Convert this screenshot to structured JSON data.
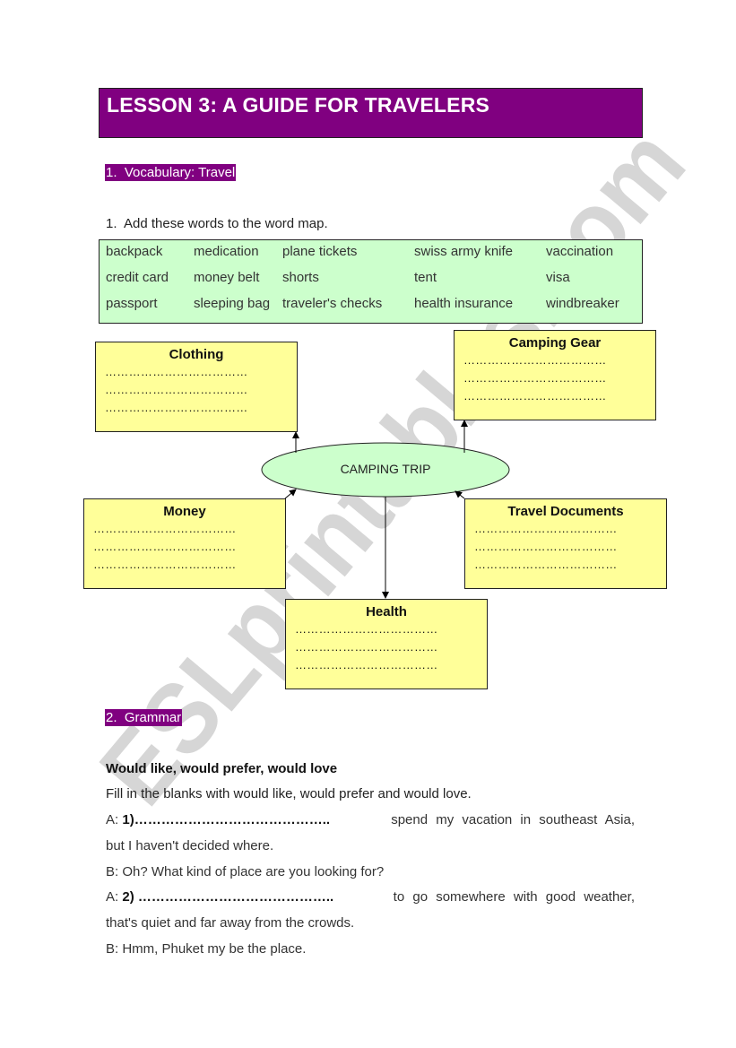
{
  "title": "LESSON 3: A GUIDE FOR TRAVELERS",
  "colors": {
    "accent_purple": "#800080",
    "word_box_green": "#ccffcc",
    "category_yellow": "#ffff99",
    "center_ellipse": "#ccffcc",
    "watermark_gray": "#c8c8c8"
  },
  "section1": {
    "heading": "1.  Vocabulary: Travel",
    "instruction": "1.  Add these words to the word map.",
    "word_columns": [
      [
        "backpack",
        "credit card",
        "passport"
      ],
      [
        "medication",
        "money belt",
        "sleeping bag"
      ],
      [
        "plane tickets",
        "shorts",
        "traveler's checks"
      ],
      [
        "swiss army knife",
        "tent",
        "health insurance"
      ],
      [
        "vaccination",
        "visa",
        "windbreaker"
      ]
    ]
  },
  "word_map": {
    "center": "CAMPING TRIP",
    "blank_line": "………………………………",
    "categories": {
      "clothing": "Clothing",
      "camping_gear": "Camping Gear",
      "money": "Money",
      "travel_documents": "Travel Documents",
      "health": "Health"
    }
  },
  "section2": {
    "heading": "2.  Grammar",
    "subheading": "Would like, would prefer, would love",
    "instruction": "Fill in the blanks with would like, would prefer and would love.",
    "dialogue": [
      {
        "speaker": "A:",
        "num": "1)",
        "blank": "……………………………………..",
        "rest": " spend my vacation in southeast Asia,"
      },
      {
        "text": "but I haven't decided where."
      },
      {
        "text": "B: Oh?  What kind of place are you looking for?"
      },
      {
        "speaker": "A:",
        "num": "2)",
        "blank": " ……………………………………..",
        "rest": " to go somewhere with good weather,"
      },
      {
        "text": "that's quiet and far away from the crowds."
      },
      {
        "text": "B: Hmm, Phuket my be the place."
      }
    ]
  },
  "watermark": "ESLprintables.com"
}
